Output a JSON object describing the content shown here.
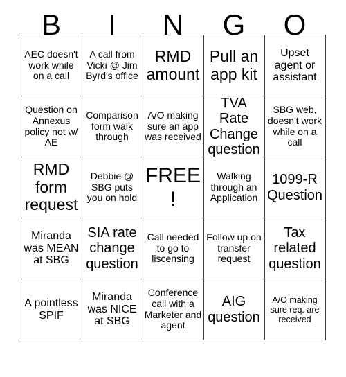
{
  "card": {
    "title": "BINGO",
    "header_letters": [
      "B",
      "I",
      "N",
      "G",
      "O"
    ],
    "grid_size": "5x5",
    "colors": {
      "background": "#ffffff",
      "text": "#000000",
      "border": "#3a3a3a"
    },
    "rows": [
      [
        {
          "text": "AEC doesn't work while on a call",
          "size": "sm",
          "marked": false
        },
        {
          "text": "A call from Vicki @ Jim Byrd's office",
          "size": "sm",
          "marked": false
        },
        {
          "text": "RMD amount",
          "size": "xl",
          "marked": false
        },
        {
          "text": "Pull an app kit",
          "size": "xl",
          "marked": false
        },
        {
          "text": "Upset agent or assistant",
          "size": "md",
          "marked": false
        }
      ],
      [
        {
          "text": "Question on Annexus policy not w/ AE",
          "size": "sm",
          "marked": false
        },
        {
          "text": "Comparison form walk through",
          "size": "sm",
          "marked": false
        },
        {
          "text": "A/O making sure an app was received",
          "size": "sm",
          "marked": false
        },
        {
          "text": "TVA Rate Change question",
          "size": "lg",
          "marked": false
        },
        {
          "text": "SBG web, doesn't work while on a call",
          "size": "sm",
          "marked": false
        }
      ],
      [
        {
          "text": "RMD form request",
          "size": "xl",
          "marked": false
        },
        {
          "text": "Debbie @ SBG puts you on hold",
          "size": "sm",
          "marked": false
        },
        {
          "text": "FREE!",
          "size": "free",
          "marked": true
        },
        {
          "text": "Walking through an Application",
          "size": "sm",
          "marked": false
        },
        {
          "text": "1099-R Question",
          "size": "lg",
          "marked": false
        }
      ],
      [
        {
          "text": "Miranda was MEAN at SBG",
          "size": "md",
          "marked": false
        },
        {
          "text": "SIA rate change question",
          "size": "lg",
          "marked": false
        },
        {
          "text": "Call needed to go to liscensing",
          "size": "sm",
          "marked": false
        },
        {
          "text": "Follow up on transfer request",
          "size": "sm",
          "marked": false
        },
        {
          "text": "Tax related question",
          "size": "lg",
          "marked": false
        }
      ],
      [
        {
          "text": "A pointless SPIF",
          "size": "md",
          "marked": false
        },
        {
          "text": "Miranda was NICE at SBG",
          "size": "md",
          "marked": false
        },
        {
          "text": "Conference call with a Marketer and agent",
          "size": "sm",
          "marked": false
        },
        {
          "text": "AIG question",
          "size": "lg",
          "marked": false
        },
        {
          "text": "A/O making sure req. are received",
          "size": "xs",
          "marked": false
        }
      ]
    ]
  }
}
